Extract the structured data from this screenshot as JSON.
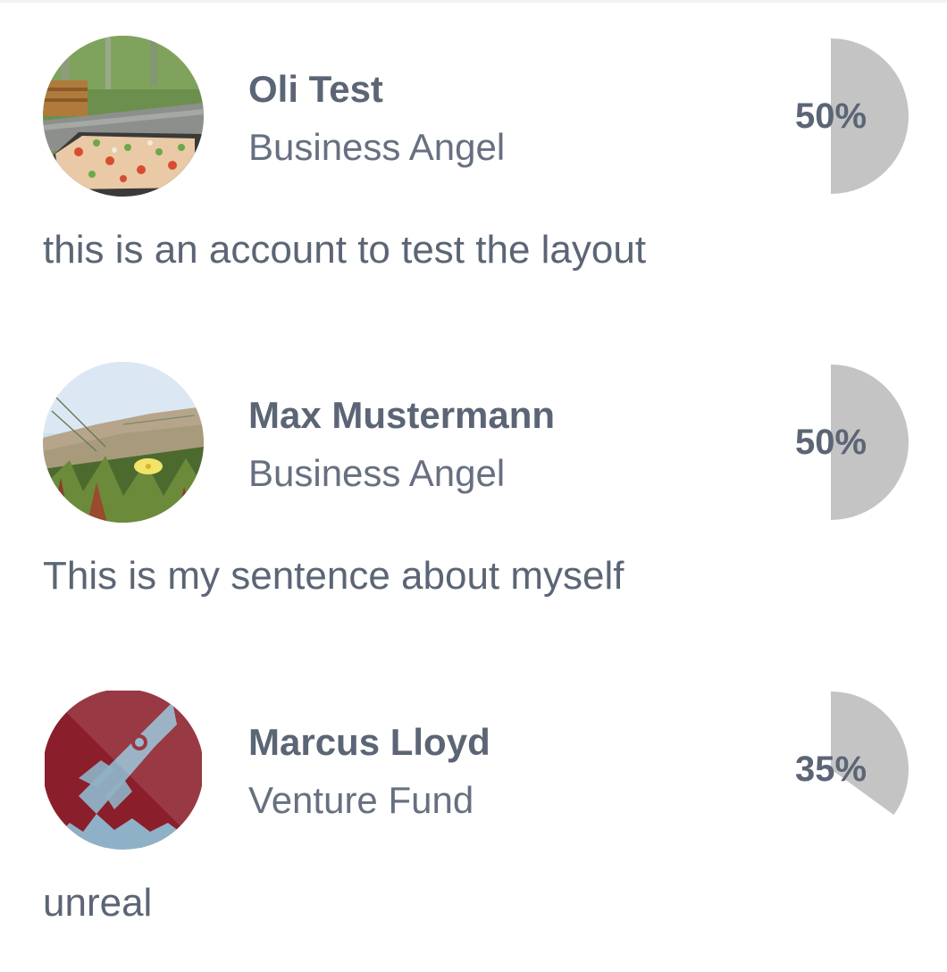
{
  "colors": {
    "text": "#5b6575",
    "gauge_fill": "#c4c4c4",
    "marcus_avatar_bg": "#8a1e2a"
  },
  "profiles": [
    {
      "name": "Oli Test",
      "role": "Business Angel",
      "bio": "this is an account to test the layout",
      "match_percent_label": "50%",
      "match_fraction": 0.5,
      "avatar_icon": "photo-pizza-garden"
    },
    {
      "name": "Max Mustermann",
      "role": "Business Angel",
      "bio": "This is my sentence about myself",
      "match_percent_label": "50%",
      "match_fraction": 0.5,
      "avatar_icon": "photo-dune-flower"
    },
    {
      "name": "Marcus Lloyd",
      "role": "Venture Fund",
      "bio": "unreal",
      "match_percent_label": "35%",
      "match_fraction": 0.35,
      "avatar_icon": "rocket-logo"
    }
  ]
}
